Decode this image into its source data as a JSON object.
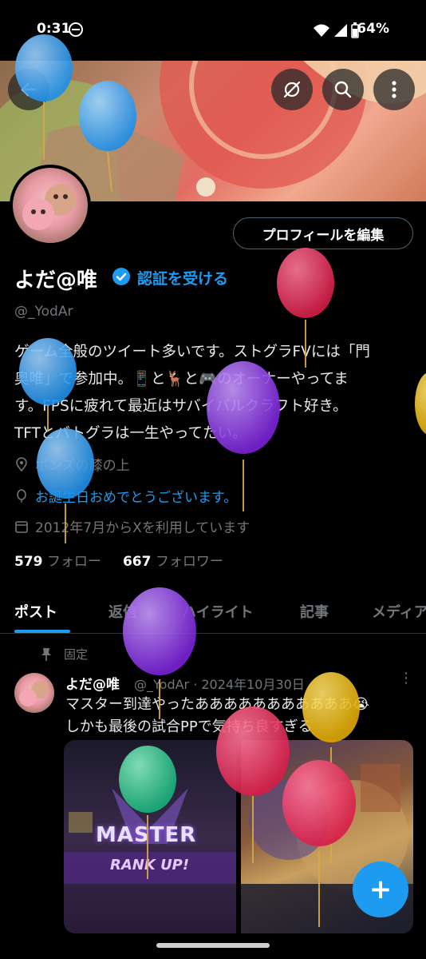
{
  "status_bar": {
    "time": "0:31",
    "battery": "64%"
  },
  "header": {
    "back_icon": "arrow-left-icon",
    "actions": [
      "no-link-icon",
      "search-icon",
      "more-vertical-icon"
    ]
  },
  "profile": {
    "edit_button": "プロフィールを編集",
    "name": "よだ@唯",
    "verify_link": "認証を受ける",
    "handle": "@_YodAr",
    "bio_lines": [
      "ゲーム全般のツイート多いです。ストグラFVには「門",
      "奥唯」で参加中。📱と🦌と🎮のオーナーやってま",
      "す。FPSに疲れて最近はサバイバルクラフト好き。",
      "TFTとバトグラは一生やってたい。"
    ],
    "location": "ポンズの膝の上",
    "birthday": "お誕生日おめでとうございます。",
    "joined": "2012年7月からXを利用しています",
    "following_count": "579",
    "following_label": "フォロー",
    "followers_count": "667",
    "followers_label": "フォロワー"
  },
  "tabs": [
    "ポスト",
    "返信",
    "ハイライト",
    "記事",
    "メディア"
  ],
  "pinned_tweet": {
    "pinned_label": "固定",
    "name": "よだ@唯",
    "meta": "@_YodAr · 2024年10月30日",
    "more": "⋮",
    "text_lines": [
      "マスター到達やったあああああああああああ😭",
      "しかも最後の試合PPで気持ち良すぎる"
    ],
    "media_text_1": "MASTER",
    "media_text_2": "RANK UP!"
  },
  "fab": {
    "label": "+"
  },
  "colors": {
    "accent": "#1d9bf0",
    "background": "#000000",
    "secondary_text": "#71767b"
  }
}
